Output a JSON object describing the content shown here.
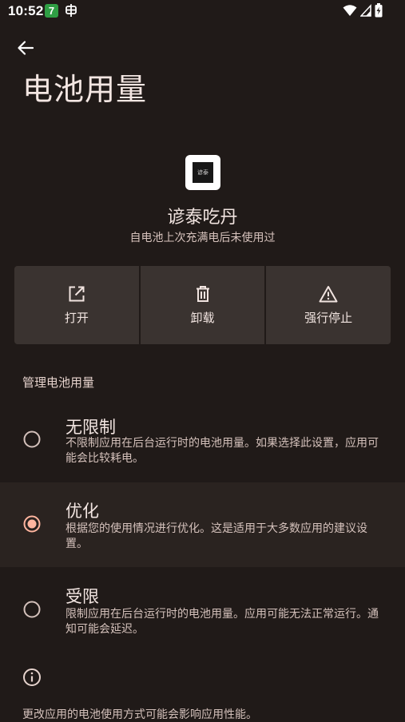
{
  "status_bar": {
    "time": "10:52",
    "notification_badge": "7",
    "notification_icon_2": "bug-icon",
    "icons": [
      "wifi-icon",
      "signal-icon",
      "battery-charging-icon"
    ]
  },
  "header": {
    "back_icon": "arrow-left-icon",
    "title": "电池用量"
  },
  "app": {
    "icon_text": "谚泰",
    "name": "谚泰吃丹",
    "subtitle": "自电池上次充满电后未使用过"
  },
  "actions": [
    {
      "label": "打开",
      "icon": "open-external-icon"
    },
    {
      "label": "卸载",
      "icon": "trash-icon"
    },
    {
      "label": "强行停止",
      "icon": "warning-triangle-icon"
    }
  ],
  "battery_section": {
    "header": "管理电池用量",
    "options": [
      {
        "title": "无限制",
        "description": "不限制应用在后台运行时的电池用量。如果选择此设置，应用可能会比较耗电。",
        "selected": false
      },
      {
        "title": "优化",
        "description": "根据您的使用情况进行优化。这是适用于大多数应用的建议设置。",
        "selected": true
      },
      {
        "title": "受限",
        "description": "限制应用在后台运行时的电池用量。应用可能无法正常运行。通知可能会延迟。",
        "selected": false
      }
    ]
  },
  "footer": {
    "info_icon": "info-icon",
    "text": "更改应用的电池使用方式可能会影响应用性能。"
  },
  "colors": {
    "background": "#201a18",
    "action_background": "#3a3330",
    "selected_row": "#2a2320",
    "text_primary": "#f3e6e2",
    "text_secondary": "#d4c1bb"
  }
}
